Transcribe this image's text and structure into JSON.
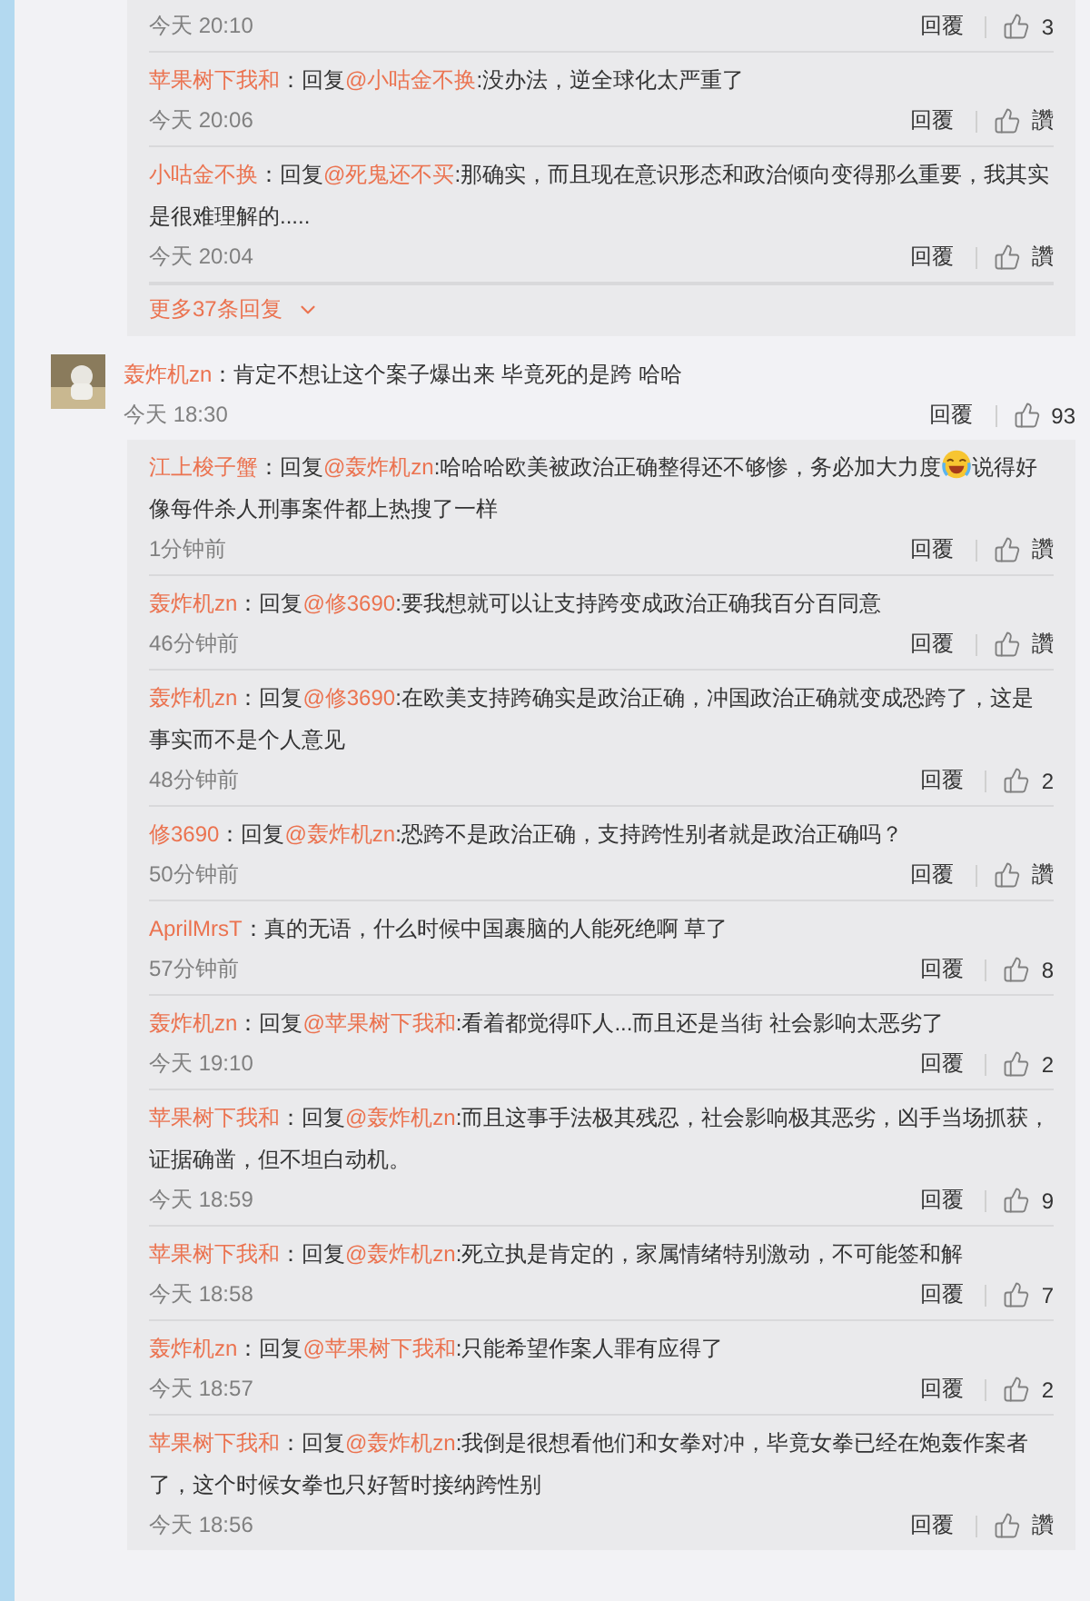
{
  "earlier_thread": {
    "replies": [
      {
        "time": "今天 20:10",
        "reply_label": "回覆",
        "likes": "3"
      },
      {
        "user": "苹果树下我和",
        "prefix": "：回复",
        "mention": "@小咕金不换",
        "body": ":没办法，逆全球化太严重了",
        "time": "今天 20:06",
        "reply_label": "回覆",
        "likes": "讚"
      },
      {
        "user": "小咕金不换",
        "prefix": "：回复",
        "mention": "@死鬼还不买",
        "body": ":那确实，而且现在意识形态和政治倾向变得那么重要，我其实是很难理解的.....",
        "time": "今天 20:04",
        "reply_label": "回覆",
        "likes": "讚"
      }
    ],
    "more": "更多37条回复"
  },
  "comment": {
    "user": "轰炸机zn",
    "prefix": "：肯定不想让这个案子爆出来 毕竟死的是跨 哈哈",
    "time": "今天 18:30",
    "reply_label": "回覆",
    "likes": "93",
    "replies": [
      {
        "user": "江上梭子蟹",
        "prefix": "：回复",
        "mention": "@轰炸机zn",
        "body": ":哈哈哈欧美被政治正确整得还不够惨，务必加大力度",
        "body_after": "说得好像每件杀人刑事案件都上热搜了一样",
        "time": "1分钟前",
        "reply_label": "回覆",
        "likes": "讚"
      },
      {
        "user": "轰炸机zn",
        "prefix": "：回复",
        "mention": "@修3690",
        "body": ":要我想就可以让支持跨变成政治正确我百分百同意",
        "time": "46分钟前",
        "reply_label": "回覆",
        "likes": "讚"
      },
      {
        "user": "轰炸机zn",
        "prefix": "：回复",
        "mention": "@修3690",
        "body": ":在欧美支持跨确实是政治正确，冲国政治正确就变成恐跨了，这是事实而不是个人意见",
        "time": "48分钟前",
        "reply_label": "回覆",
        "likes": "2"
      },
      {
        "user": "修3690",
        "prefix": "：回复",
        "mention": "@轰炸机zn",
        "body": ":恐跨不是政治正确，支持跨性别者就是政治正确吗？",
        "time": "50分钟前",
        "reply_label": "回覆",
        "likes": "讚"
      },
      {
        "user": "AprilMrsT",
        "prefix": "：真的无语，什么时候中国裹脑的人能死绝啊 草了",
        "time": "57分钟前",
        "reply_label": "回覆",
        "likes": "8"
      },
      {
        "user": "轰炸机zn",
        "prefix": "：回复",
        "mention": "@苹果树下我和",
        "body": ":看着都觉得吓人...而且还是当街 社会影响太恶劣了",
        "time": "今天 19:10",
        "reply_label": "回覆",
        "likes": "2"
      },
      {
        "user": "苹果树下我和",
        "prefix": "：回复",
        "mention": "@轰炸机zn",
        "body": ":而且这事手法极其残忍，社会影响极其恶劣，凶手当场抓获，证据确凿，但不坦白动机。",
        "time": "今天 18:59",
        "reply_label": "回覆",
        "likes": "9"
      },
      {
        "user": "苹果树下我和",
        "prefix": "：回复",
        "mention": "@轰炸机zn",
        "body": ":死立执是肯定的，家属情绪特别激动，不可能签和解",
        "time": "今天 18:58",
        "reply_label": "回覆",
        "likes": "7"
      },
      {
        "user": "轰炸机zn",
        "prefix": "：回复",
        "mention": "@苹果树下我和",
        "body": ":只能希望作案人罪有应得了",
        "time": "今天 18:57",
        "reply_label": "回覆",
        "likes": "2"
      },
      {
        "user": "苹果树下我和",
        "prefix": "：回复",
        "mention": "@轰炸机zn",
        "body": ":我倒是很想看他们和女拳对冲，毕竟女拳已经在炮轰作案者了，这个时候女拳也只好暂时接纳跨性别",
        "time": "今天 18:56",
        "reply_label": "回覆",
        "likes": "讚"
      }
    ]
  }
}
